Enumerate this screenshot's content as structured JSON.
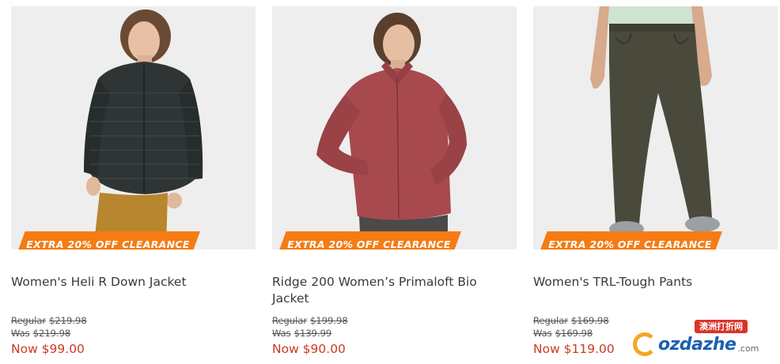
{
  "products": [
    {
      "badge": "EXTRA 20% OFF CLEARANCE",
      "name": "Women's Heli R Down Jacket",
      "regular_label": "Regular",
      "regular_price": "$219.98",
      "was_label": "Was",
      "was_price": "$219.98",
      "now": "Now $99.00"
    },
    {
      "badge": "EXTRA 20% OFF CLEARANCE",
      "name": "Ridge 200 Women’s Primaloft Bio Jacket",
      "regular_label": "Regular",
      "regular_price": "$199.98",
      "was_label": "Was",
      "was_price": "$139.99",
      "now": "Now $90.00"
    },
    {
      "badge": "EXTRA 20% OFF CLEARANCE",
      "name": "Women's TRL-Tough Pants",
      "regular_label": "Regular",
      "regular_price": "$169.98",
      "was_label": "Was",
      "was_price": "$169.98",
      "now": "Now $119.00"
    }
  ],
  "watermark": {
    "tag": "澳洲打折网",
    "logo_text": "ozdazhe",
    "domain": ".com"
  },
  "colors": {
    "badge": "#f57c14",
    "now_price": "#cc3b1e",
    "image_bg": "#eeeeee",
    "jacket_1": "#2f3535",
    "jacket_2": "#a84a4d",
    "pants_3": "#4a4a3c"
  }
}
